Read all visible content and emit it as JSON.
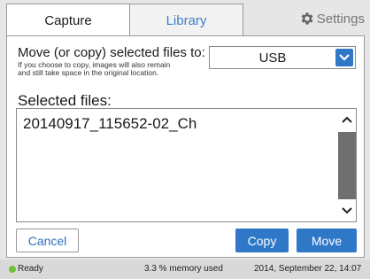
{
  "tabs": {
    "capture": "Capture",
    "library": "Library",
    "settings": "Settings"
  },
  "move_dialog": {
    "prompt": "Move (or copy) selected files to:",
    "note_line1": "If you choose to copy, images will also remain",
    "note_line2": "and still take space in the original location.",
    "destination": {
      "selected": "USB",
      "icon": "chevron-down-icon"
    },
    "selected_heading": "Selected files:",
    "files": [
      "20140917_115652-02_Ch"
    ]
  },
  "buttons": {
    "cancel": "Cancel",
    "copy": "Copy",
    "move": "Move"
  },
  "status": {
    "ready": "Ready",
    "memory": "3.3 % memory used",
    "datetime": "2014, September 22, 14:07"
  },
  "colors": {
    "accent": "#2f78c8",
    "ready_indicator": "#6cc03a"
  }
}
